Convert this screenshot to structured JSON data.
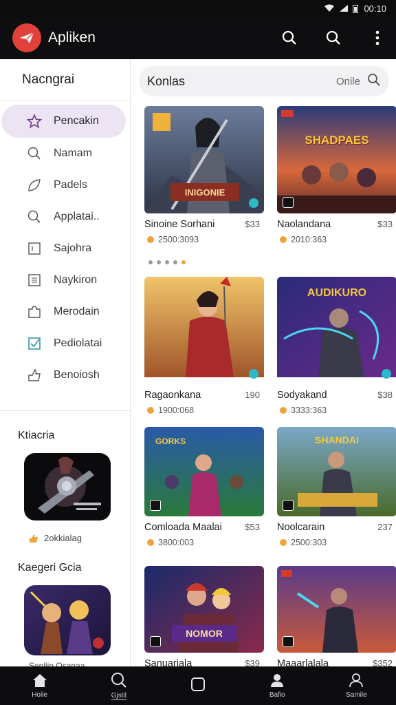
{
  "status_bar": {
    "time": "00:10"
  },
  "app_bar": {
    "title": "Apliken",
    "logo_icon": "paper-plane-icon"
  },
  "sidebar": {
    "header": "Nacngrai",
    "items": [
      {
        "label": "Pencakin",
        "icon": "star-icon",
        "active": true
      },
      {
        "label": "Namam",
        "icon": "search-icon"
      },
      {
        "label": "Padels",
        "icon": "leaf-icon"
      },
      {
        "label": "Applatai..",
        "icon": "search-icon"
      },
      {
        "label": "Sajohra",
        "icon": "square-icon"
      },
      {
        "label": "Naykiron",
        "icon": "grid-icon"
      },
      {
        "label": "Merodain",
        "icon": "puzzle-icon"
      },
      {
        "label": "Pediolatai",
        "icon": "check-box-icon"
      },
      {
        "label": "Benoiosh",
        "icon": "thumb-up-icon"
      }
    ],
    "featured": {
      "title": "Ktiacria",
      "meta": "2okkialag"
    },
    "category": {
      "title": "Kaegeri Gcia",
      "caption": "Senliin Osanaa"
    }
  },
  "search": {
    "value": "Konlas",
    "hint": "Onile"
  },
  "games": [
    {
      "name": "Sinoine Sorhani",
      "price": "$33",
      "stats": "2500:3093",
      "art": "warrior-a",
      "banner": "INIGONIE"
    },
    {
      "name": "Naolandana",
      "price": "$33",
      "stats": "2010:363",
      "art": "battle-b",
      "banner": "SHADPAES"
    },
    {
      "name": "Ragaonkana",
      "price": "190",
      "stats": "1900:068",
      "art": "hero-c",
      "banner": ""
    },
    {
      "name": "Sodyakand",
      "price": "$38",
      "stats": "3333:363",
      "art": "mech-d",
      "banner": "AUDIKURO"
    },
    {
      "name": "Comloada Maalai",
      "price": "$53",
      "stats": "3800:003",
      "art": "squad-e",
      "banner": "GORKS"
    },
    {
      "name": "Noolcarain",
      "price": "237",
      "stats": "2500:303",
      "art": "soldier-f",
      "banner": "SHANDAI"
    },
    {
      "name": "Sanuariala",
      "price": "$39",
      "stats": "",
      "art": "duo-g",
      "banner": "NOMOR"
    },
    {
      "name": "Maaarlalala",
      "price": "$352",
      "stats": "",
      "art": "ninja-h",
      "banner": ""
    }
  ],
  "bottom_nav": [
    {
      "label": "Hoile",
      "icon": "home-icon"
    },
    {
      "label": "Gjstil",
      "icon": "search-icon",
      "active": true
    },
    {
      "label": "",
      "icon": "square-icon"
    },
    {
      "label": "Bafio",
      "icon": "person-icon"
    },
    {
      "label": "Samile",
      "icon": "profile-icon"
    }
  ],
  "colors": {
    "app_bar": "#0e0e10",
    "accent": "#e0413a",
    "active_nav": "#ece4f3",
    "rating": "#f0a33a"
  }
}
